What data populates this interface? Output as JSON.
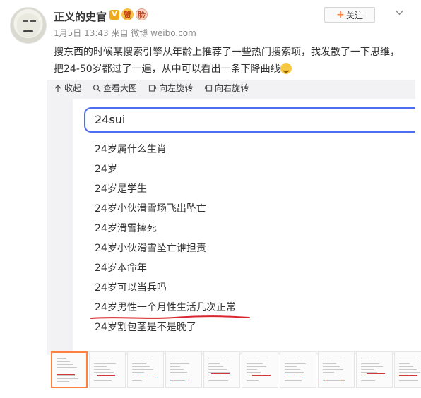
{
  "post": {
    "username": "正义的史官",
    "meta": "1月5日 13:43 来自 微博 weibo.com",
    "text_line1": "搜东西的时候某搜索引擎从年龄上推荐了一些热门搜索项，我发散了一下思维，",
    "text_line2": "把24-50岁都过了一遍，从中可以看出一条下降曲线",
    "follow_label": "关注",
    "follow_plus": "+"
  },
  "badges": [
    "V",
    "赞",
    "脸"
  ],
  "toolbar": {
    "collapse": "收起",
    "view_large": "查看大图",
    "rotate_left": "向左旋转",
    "rotate_right": "向右旋转"
  },
  "screenshot": {
    "search_value": "24sui",
    "suggestions": [
      "24岁属什么生肖",
      "24岁",
      "24岁是学生",
      "24岁小伙滑雪场飞出坠亡",
      "24岁滑雪摔死",
      "24岁小伙滑雪坠亡谁担责",
      "24岁本命年",
      "24岁可以当兵吗",
      "24岁男性一个月性生活几次正常",
      "24岁割包茎是不是晚了"
    ],
    "highlight_color": "#d9262f",
    "accent_color": "#4e6ef2"
  },
  "thumbnails": {
    "count": 10,
    "active_index": 0,
    "active_color": "#ff8140"
  },
  "icons": {
    "collapse": "arrow-up-icon",
    "view_large": "magnify-icon",
    "rotate_left": "rotate-left-icon",
    "rotate_right": "rotate-right-icon",
    "menu": "chevron-down-icon"
  }
}
